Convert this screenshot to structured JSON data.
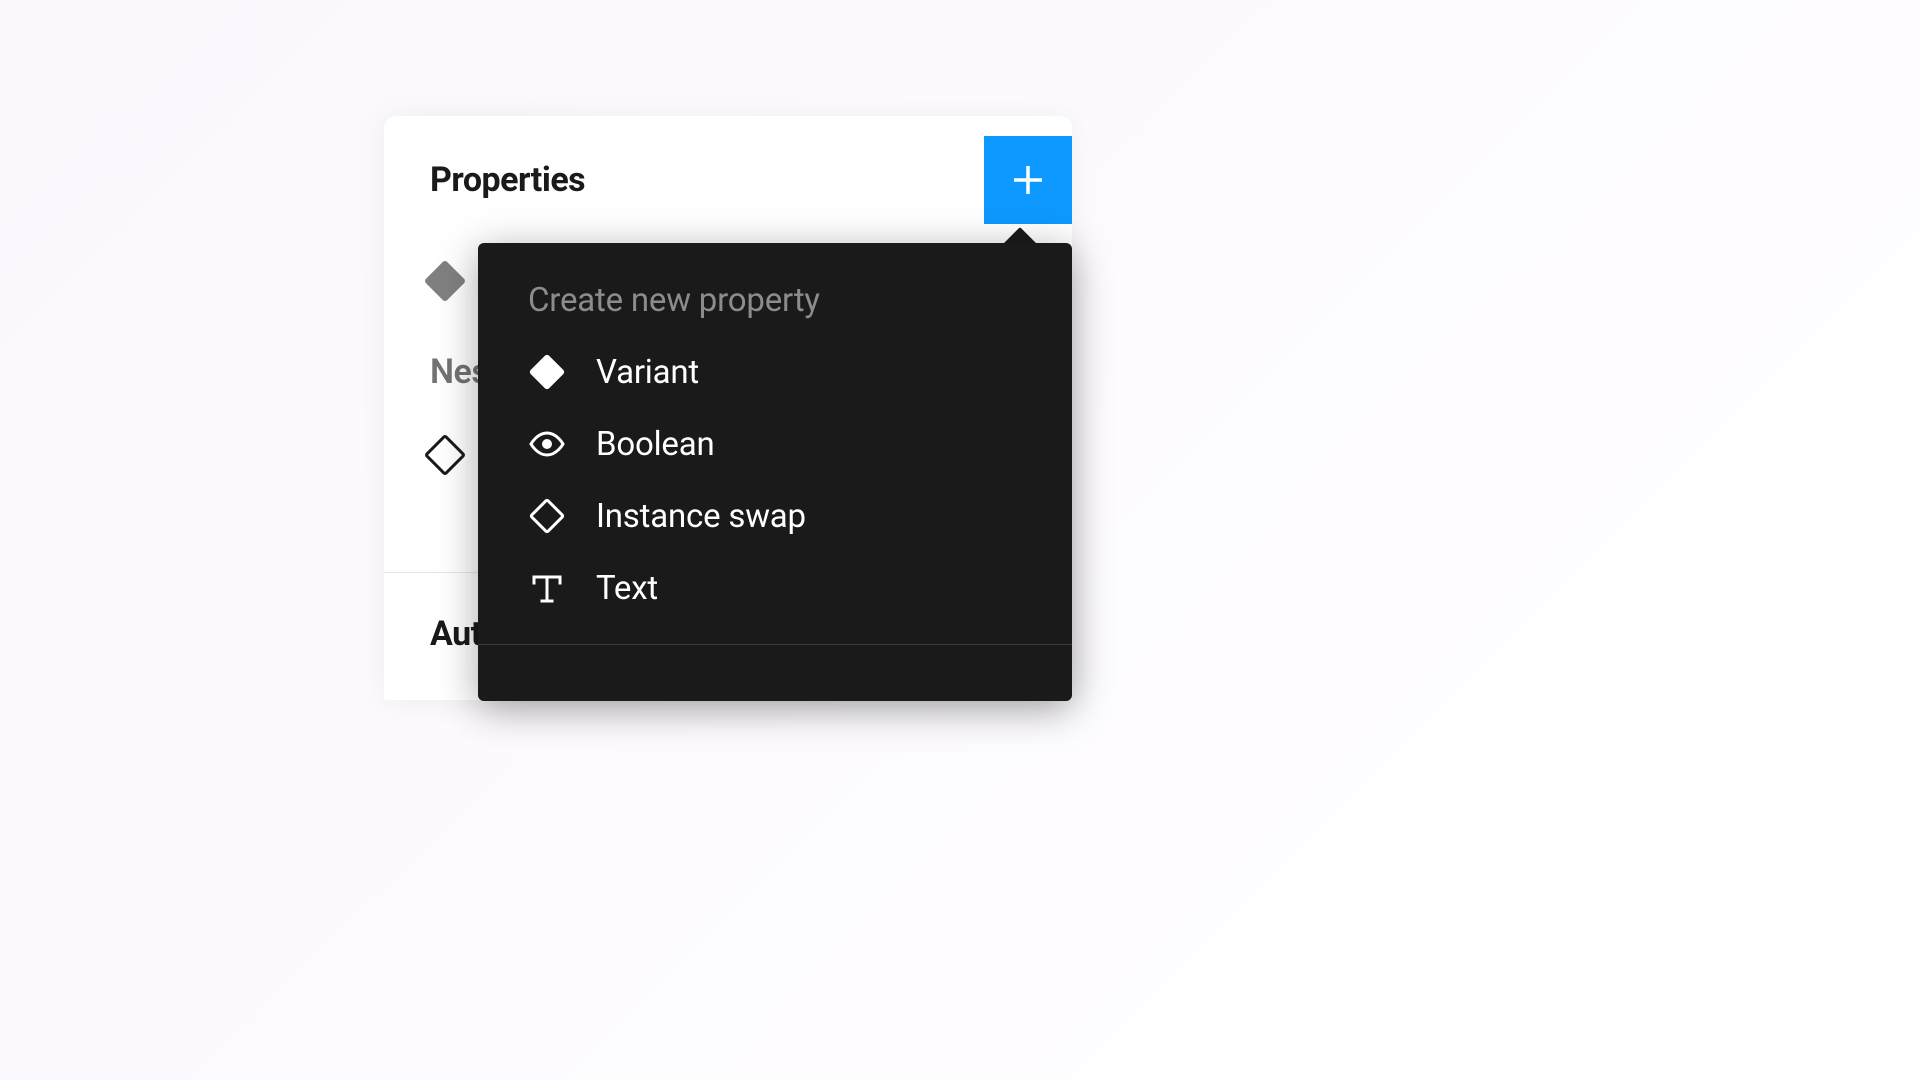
{
  "panel": {
    "title": "Properties",
    "section_nested_label": "Nes",
    "section_auto_label": "Aut"
  },
  "dropdown": {
    "heading": "Create new property",
    "items": [
      {
        "icon": "diamond-filled",
        "label": "Variant"
      },
      {
        "icon": "eye",
        "label": "Boolean"
      },
      {
        "icon": "diamond-outline",
        "label": "Instance swap"
      },
      {
        "icon": "text",
        "label": "Text"
      }
    ]
  },
  "colors": {
    "accent": "#0d99ff",
    "dropdown_bg": "#1a1a1a"
  }
}
